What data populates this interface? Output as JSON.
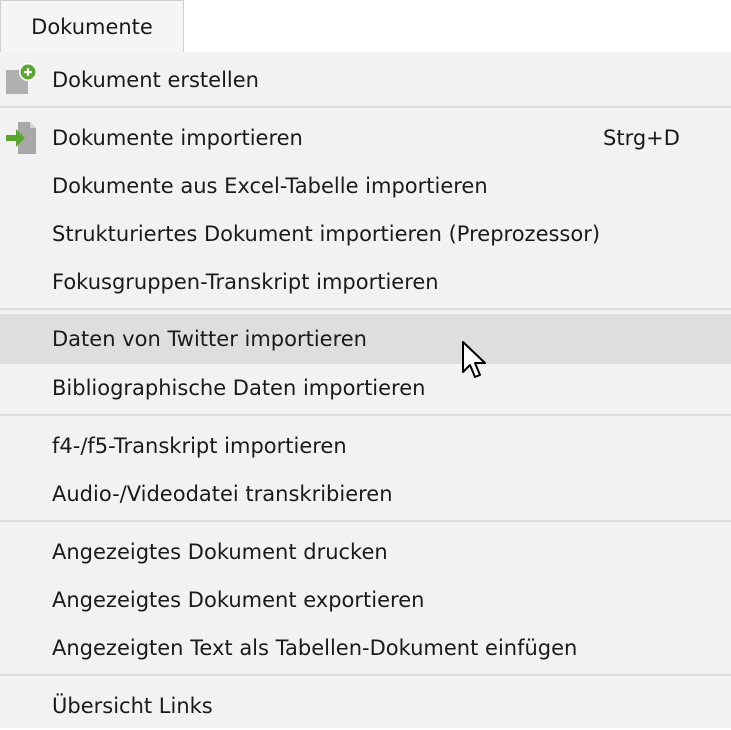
{
  "menu": {
    "title": "Dokumente",
    "items": [
      {
        "label": "Dokument erstellen",
        "icon": "new-document-icon"
      },
      {
        "label": "Dokumente importieren",
        "shortcut": "Strg+D",
        "icon": "import-document-icon"
      },
      {
        "label": "Dokumente aus Excel-Tabelle importieren"
      },
      {
        "label": "Strukturiertes Dokument importieren (Preprozessor)"
      },
      {
        "label": "Fokusgruppen-Transkript importieren"
      },
      {
        "label": "Daten von Twitter importieren",
        "highlighted": true
      },
      {
        "label": "Bibliographische Daten importieren"
      },
      {
        "label": "f4-/f5-Transkript importieren"
      },
      {
        "label": "Audio-/Videodatei transkribieren"
      },
      {
        "label": "Angezeigtes Dokument drucken"
      },
      {
        "label": "Angezeigtes Dokument exportieren"
      },
      {
        "label": "Angezeigten Text als Tabellen-Dokument einfügen"
      },
      {
        "label": "Übersicht Links"
      }
    ]
  },
  "colors": {
    "menu_background": "#f2f2f2",
    "highlight": "#dedede",
    "separator": "#dcdcdc",
    "icon_green": "#5aa832",
    "icon_gray": "#a8a8a8"
  }
}
